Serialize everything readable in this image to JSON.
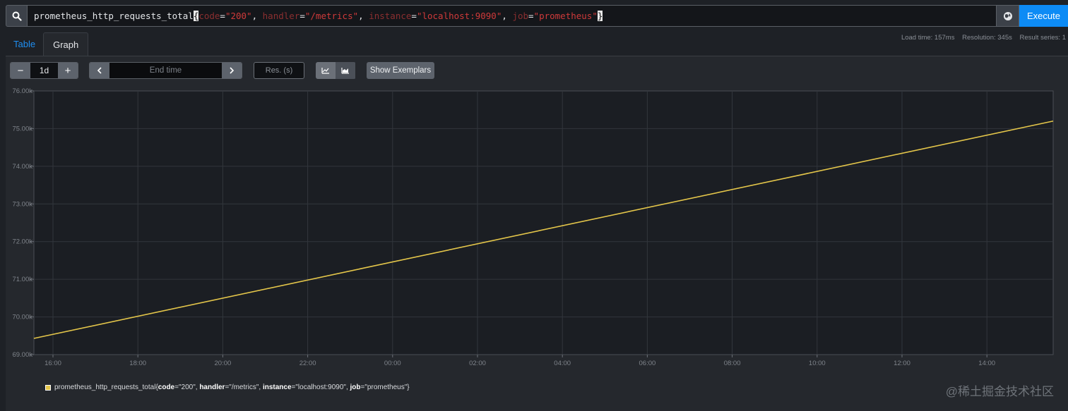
{
  "query": {
    "metric": "prometheus_http_requests_total",
    "labels": [
      {
        "name": "code",
        "value": "\"200\""
      },
      {
        "name": "handler",
        "value": "\"/metrics\""
      },
      {
        "name": "instance",
        "value": "\"localhost:9090\""
      },
      {
        "name": "job",
        "value": "\"prometheus\""
      }
    ],
    "execute_label": "Execute"
  },
  "tabs": [
    {
      "label": "Table"
    },
    {
      "label": "Graph"
    }
  ],
  "stats": {
    "load_time": "Load time: 157ms",
    "resolution": "Resolution: 345s",
    "result_series": "Result series: 1"
  },
  "controls": {
    "range_minus": "−",
    "range_value": "1d",
    "range_plus": "+",
    "end_time_placeholder": "End time",
    "resolution_placeholder": "Res. (s)",
    "exemplars_label": "Show Exemplars"
  },
  "chart_data": {
    "type": "line",
    "ylim": [
      69000,
      76000
    ],
    "y_ticks": [
      "69.00k",
      "70.00k",
      "71.00k",
      "72.00k",
      "73.00k",
      "74.00k",
      "75.00k",
      "76.00k"
    ],
    "x_ticks": [
      "16:00",
      "18:00",
      "20:00",
      "22:00",
      "00:00",
      "02:00",
      "04:00",
      "06:00",
      "08:00",
      "10:00",
      "12:00",
      "14:00"
    ],
    "series": [
      {
        "color": "#e4c64a",
        "x": [
          "15:33",
          "15:33 +1d"
        ],
        "values": [
          69430,
          75200
        ]
      }
    ]
  },
  "legend": {
    "metric": "prometheus_http_requests_total",
    "items": [
      {
        "key": "code",
        "value": "=\"200\""
      },
      {
        "key": "handler",
        "value": "=\"/metrics\""
      },
      {
        "key": "instance",
        "value": "=\"localhost:9090\""
      },
      {
        "key": "job",
        "value": "=\"prometheus\""
      }
    ]
  },
  "watermark": "@稀土掘金技术社区",
  "colors": {
    "accent": "#0d8bf5",
    "series": "#e4c64a"
  }
}
